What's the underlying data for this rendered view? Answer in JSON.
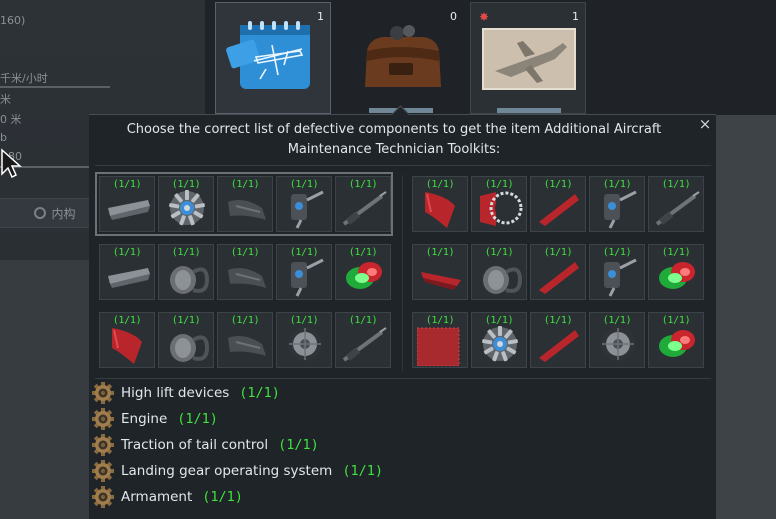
{
  "background": {
    "left_texts": [
      "160)",
      "千米/小时",
      "米",
      "0 米",
      "b",
      "80"
    ],
    "button_label": "内构"
  },
  "items": [
    {
      "count": "1",
      "icon": "blueprint-icon"
    },
    {
      "count": "0",
      "icon": "toolkit-bag-icon"
    },
    {
      "count": "1",
      "icon": "aircraft-photo-icon",
      "badge": "✸"
    }
  ],
  "dialog": {
    "title": "Choose the correct list of defective components to get the item Additional Aircraft Maintenance Technician Toolkits:",
    "close": "×"
  },
  "sets": [
    {
      "rows": [
        [
          {
            "q": "(1/1)",
            "icon": "wing-flap"
          },
          {
            "q": "(1/1)",
            "icon": "radial-engine"
          },
          {
            "q": "(1/1)",
            "icon": "tail-control"
          },
          {
            "q": "(1/1)",
            "icon": "landing-gear-strut"
          },
          {
            "q": "(1/1)",
            "icon": "gun-barrel"
          }
        ],
        [
          {
            "q": "(1/1)",
            "icon": "wing-flap"
          },
          {
            "q": "(1/1)",
            "icon": "inline-engine"
          },
          {
            "q": "(1/1)",
            "icon": "tail-control"
          },
          {
            "q": "(1/1)",
            "icon": "landing-gear-strut"
          },
          {
            "q": "(1/1)",
            "icon": "landing-light"
          }
        ],
        [
          {
            "q": "(1/1)",
            "icon": "red-aileron"
          },
          {
            "q": "(1/1)",
            "icon": "inline-engine"
          },
          {
            "q": "(1/1)",
            "icon": "tail-control"
          },
          {
            "q": "(1/1)",
            "icon": "wheel"
          },
          {
            "q": "(1/1)",
            "icon": "gun-barrel"
          }
        ]
      ]
    },
    {
      "rows": [
        [
          {
            "q": "(1/1)",
            "icon": "red-aileron"
          },
          {
            "q": "(1/1)",
            "icon": "red-engine-ring"
          },
          {
            "q": "(1/1)",
            "icon": "red-tail"
          },
          {
            "q": "(1/1)",
            "icon": "landing-gear-strut"
          },
          {
            "q": "(1/1)",
            "icon": "gun-barrel"
          }
        ],
        [
          {
            "q": "(1/1)",
            "icon": "red-wing-flap"
          },
          {
            "q": "(1/1)",
            "icon": "inline-engine"
          },
          {
            "q": "(1/1)",
            "icon": "red-tail"
          },
          {
            "q": "(1/1)",
            "icon": "landing-gear-strut"
          },
          {
            "q": "(1/1)",
            "icon": "landing-light"
          }
        ],
        [
          {
            "q": "(1/1)",
            "icon": "red-panel"
          },
          {
            "q": "(1/1)",
            "icon": "radial-engine"
          },
          {
            "q": "(1/1)",
            "icon": "red-tail"
          },
          {
            "q": "(1/1)",
            "icon": "wheel"
          },
          {
            "q": "(1/1)",
            "icon": "landing-light"
          }
        ]
      ]
    }
  ],
  "requirements": [
    {
      "name": "High lift devices",
      "progress": "(1/1)"
    },
    {
      "name": "Engine",
      "progress": "(1/1)"
    },
    {
      "name": "Traction of tail control",
      "progress": "(1/1)"
    },
    {
      "name": "Landing gear operating system",
      "progress": "(1/1)"
    },
    {
      "name": "Armament",
      "progress": "(1/1)"
    }
  ],
  "colors": {
    "progress_green": "#3fe23f",
    "part_red": "#b8262c",
    "part_gray": "#8b9196"
  }
}
